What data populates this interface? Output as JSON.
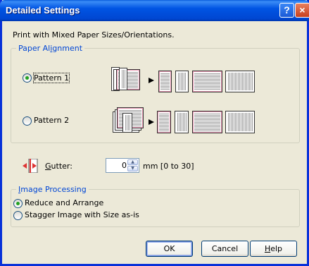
{
  "window": {
    "title": "Detailed Settings",
    "help_glyph": "?",
    "close_glyph": "×"
  },
  "heading": "Print with Mixed Paper Sizes/Orientations.",
  "paper_alignment": {
    "legend_pre": "Paper Al",
    "legend_mnemonic": "i",
    "legend_post": "gnment",
    "options": [
      {
        "label": "Pattern 1",
        "checked": true
      },
      {
        "label": "Pattern 2",
        "checked": false
      }
    ]
  },
  "gutter": {
    "label_mnemonic": "G",
    "label_rest": "utter:",
    "value": "0",
    "range": "mm [0 to 30]"
  },
  "image_processing": {
    "legend_mnemonic": "I",
    "legend_rest": "mage Processing",
    "options": [
      {
        "label": "Reduce and Arrange",
        "checked": true
      },
      {
        "label": "Stagger Image with Size as-is",
        "checked": false
      }
    ]
  },
  "buttons": {
    "ok": "OK",
    "cancel": "Cancel",
    "help_mnemonic": "H",
    "help_rest": "elp"
  },
  "icons": {
    "help": "question-mark-icon",
    "close": "close-icon",
    "gutter": "gutter-icon",
    "arrow": "right-arrow-icon"
  },
  "colors": {
    "titlebar": "#0054e3",
    "dialog_bg": "#ece9d8",
    "group_legend": "#0046d5",
    "radio_dot": "#21a121"
  }
}
